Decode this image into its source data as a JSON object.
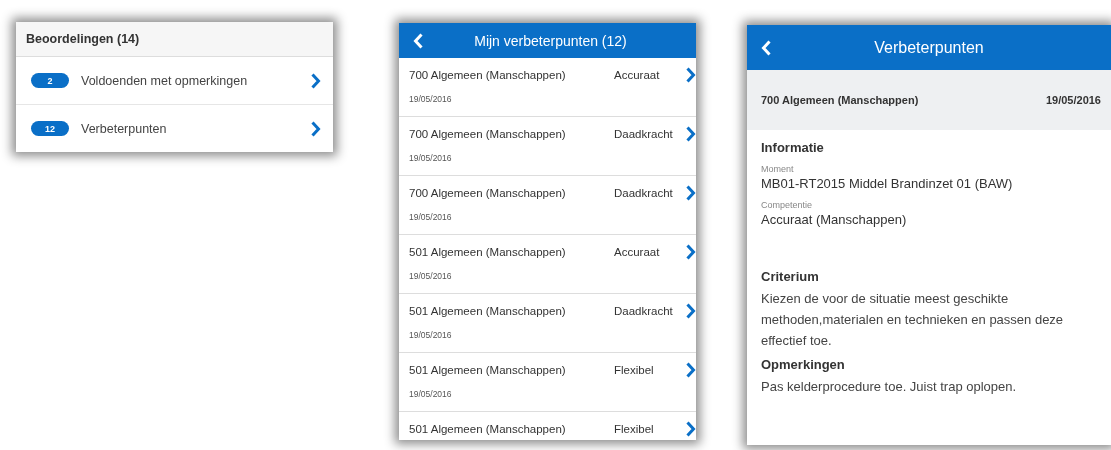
{
  "summary_card": {
    "title": "Beoordelingen (14)",
    "items": [
      {
        "count": "2",
        "label": "Voldoenden met opmerkingen"
      },
      {
        "count": "12",
        "label": "Verbeterpunten"
      }
    ]
  },
  "list_screen": {
    "title": "Mijn verbeterpunten (12)",
    "rows": [
      {
        "name": "700 Algemeen (Manschappen)",
        "competence": "Accuraat",
        "date": "19/05/2016"
      },
      {
        "name": "700 Algemeen (Manschappen)",
        "competence": "Daadkracht",
        "date": "19/05/2016"
      },
      {
        "name": "700 Algemeen (Manschappen)",
        "competence": "Daadkracht",
        "date": "19/05/2016"
      },
      {
        "name": "501 Algemeen (Manschappen)",
        "competence": "Accuraat",
        "date": "19/05/2016"
      },
      {
        "name": "501 Algemeen (Manschappen)",
        "competence": "Daadkracht",
        "date": "19/05/2016"
      },
      {
        "name": "501 Algemeen (Manschappen)",
        "competence": "Flexibel",
        "date": "19/05/2016"
      },
      {
        "name": "501 Algemeen (Manschappen)",
        "competence": "Flexibel"
      }
    ]
  },
  "detail_screen": {
    "title": "Verbeterpunten",
    "subject": "700 Algemeen (Manschappen)",
    "date": "19/05/2016",
    "info_heading": "Informatie",
    "fields": [
      {
        "label": "Moment",
        "value": "MB01-RT2015 Middel Brandinzet 01 (BAW)"
      },
      {
        "label": "Competentie",
        "value": "Accuraat (Manschappen)"
      }
    ],
    "criterion_heading": "Criterium",
    "criterion": "Kiezen de voor de situatie meest geschikte methoden,materialen en technieken en passen deze effectief toe.",
    "remarks_heading": "Opmerkingen",
    "remarks": "Pas kelderprocedure toe. Juist trap oplopen."
  }
}
